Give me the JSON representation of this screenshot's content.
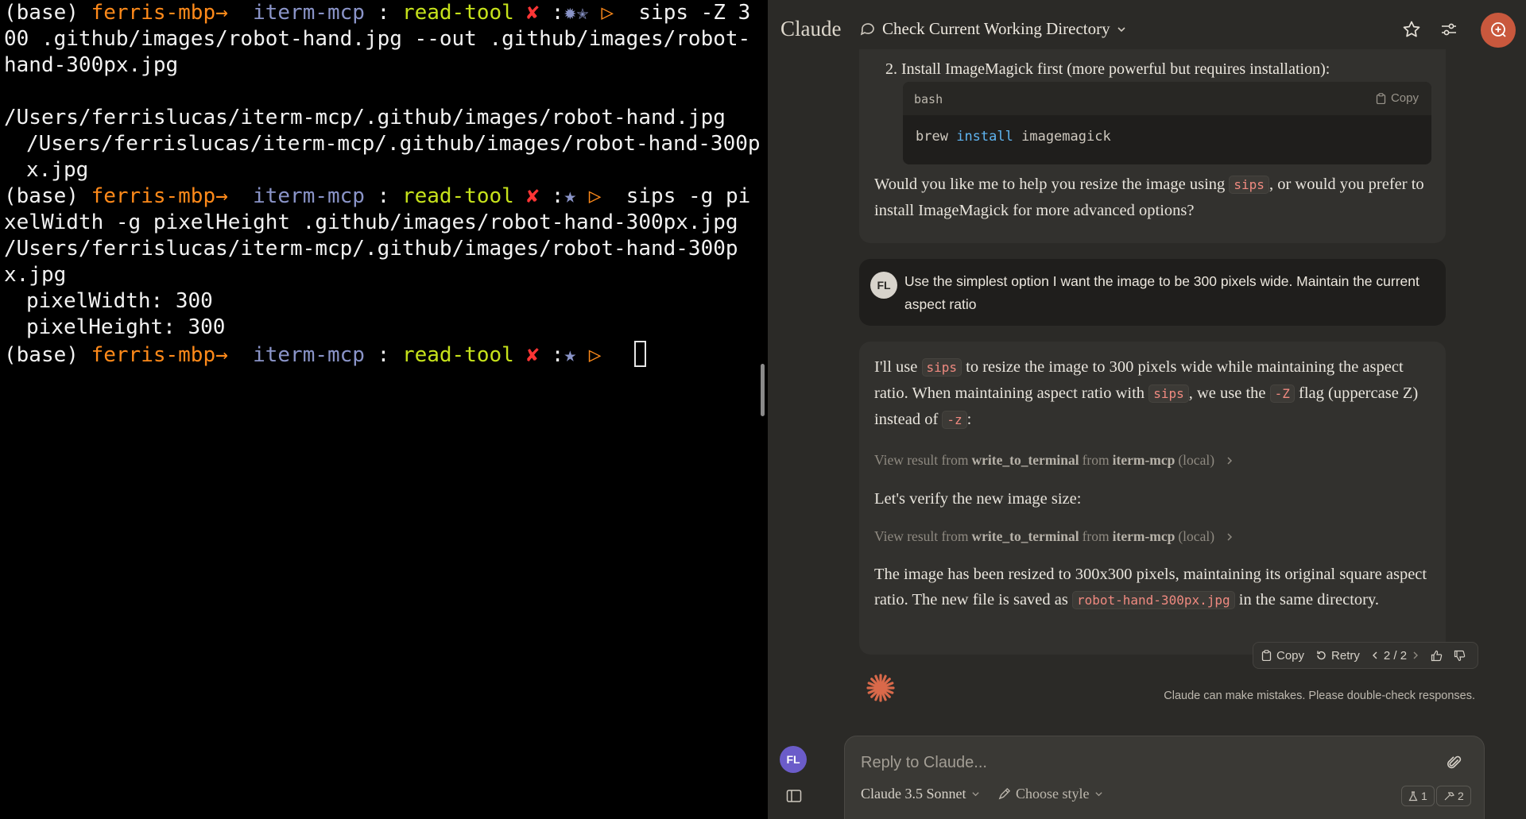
{
  "terminal": {
    "lines": [
      {
        "prompt": {
          "base": "(base)",
          "host": "ferris-mbp",
          "arrow": "→",
          "dir": "iterm-mcp",
          "sep": ":",
          "branch": "read-tool",
          "x": "✘",
          "colon": ":",
          "star": "✹✭",
          "tri": "▷"
        },
        "command": "sips -Z 300 .github/images/robot-hand.jpg --out .github/images/robot-hand-300px.jpg"
      },
      {
        "text": ""
      },
      {
        "text": "/Users/ferrislucas/iterm-mcp/.github/images/robot-hand.jpg"
      },
      {
        "text": "/Users/ferrislucas/iterm-mcp/.github/images/robot-hand-300px.jpg",
        "indent": true
      },
      {
        "prompt": {
          "base": "(base)",
          "host": "ferris-mbp",
          "arrow": "→",
          "dir": "iterm-mcp",
          "sep": ":",
          "branch": "read-tool",
          "x": "✘",
          "colon": ":",
          "star": "★",
          "tri": "▷"
        },
        "command": "sips -g pixelWidth -g pixelHeight .github/images/robot-hand-300px.jpg"
      },
      {
        "text": "/Users/ferrislucas/iterm-mcp/.github/images/robot-hand-300px.jpg"
      },
      {
        "text": "pixelWidth: 300",
        "indent": true
      },
      {
        "text": "pixelHeight: 300",
        "indent": true
      },
      {
        "prompt": {
          "base": "(base)",
          "host": "ferris-mbp",
          "arrow": "→",
          "dir": "iterm-mcp",
          "sep": ":",
          "branch": "read-tool",
          "x": "✘",
          "colon": ":",
          "star": "★",
          "tri": "▷"
        },
        "command": "",
        "cursor": true
      }
    ]
  },
  "claude": {
    "brand": "Claude",
    "chat_title": "Check Current Working Directory",
    "prev_assistant": {
      "list_item": "2. Install ImageMagick first (more powerful but requires installation):",
      "code_lang": "bash",
      "code_copy": "Copy",
      "code_cmd": "brew",
      "code_kw": "install",
      "code_arg": "imagemagick",
      "para_a": "Would you like me to help you resize the image using ",
      "para_code": "sips",
      "para_b": ", or would you prefer to install ImageMagick for more advanced options?"
    },
    "user_message": {
      "initials": "FL",
      "text": "Use the simplest option I want the image to be 300 pixels wide. Maintain the current aspect ratio"
    },
    "assistant": {
      "p1_a": "I'll use ",
      "p1_code1": "sips",
      "p1_b": " to resize the image to 300 pixels wide while maintaining the aspect ratio. When maintaining aspect ratio with ",
      "p1_code2": "sips",
      "p1_c": ", we use the ",
      "p1_code3": "-Z",
      "p1_d": " flag (uppercase Z) instead of ",
      "p1_code4": "-z",
      "p1_e": ":",
      "tool1": {
        "prefix": "View result from ",
        "tool": "write_to_terminal",
        "mid": " from ",
        "server": "iterm-mcp",
        "suffix": " (local)"
      },
      "p2": "Let's verify the new image size:",
      "tool2": {
        "prefix": "View result from ",
        "tool": "write_to_terminal",
        "mid": " from ",
        "server": "iterm-mcp",
        "suffix": " (local)"
      },
      "p3_a": "The image has been resized to 300x300 pixels, maintaining its original square aspect ratio. The new file is saved as ",
      "p3_code": "robot-hand-300px.jpg",
      "p3_b": " in the same directory."
    },
    "actions": {
      "copy": "Copy",
      "retry": "Retry",
      "pager": "2 / 2"
    },
    "disclaimer": "Claude can make mistakes. Please double-check responses.",
    "input": {
      "placeholder": "Reply to Claude...",
      "model": "Claude 3.5 Sonnet",
      "style": "Choose style",
      "badge1": "1",
      "badge2": "2"
    },
    "side_avatar": "FL",
    "colors": {
      "accent": "#c9583d",
      "avatar": "#6b5cc9",
      "code_text": "#f08a80"
    }
  }
}
